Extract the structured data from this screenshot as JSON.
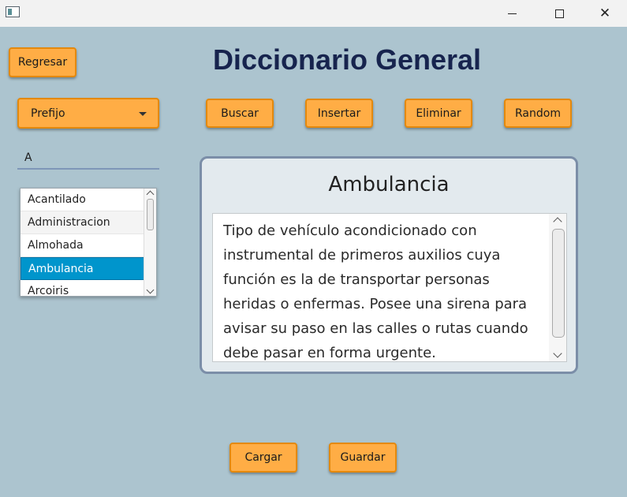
{
  "window": {
    "minimize_glyph": "minimize-icon",
    "maximize_glyph": "maximize-icon",
    "close_glyph": "✕"
  },
  "header": {
    "back_label": "Regresar",
    "title": "Diccionario General"
  },
  "toolbar": {
    "search_label": "Buscar",
    "insert_label": "Insertar",
    "delete_label": "Eliminar",
    "random_label": "Random"
  },
  "filter": {
    "mode_selected": "Prefijo",
    "query_value": "A"
  },
  "word_list": {
    "items": [
      "Acantilado",
      "Administracion",
      "Almohada",
      "Ambulancia",
      "Arcoiris"
    ],
    "selected": "Ambulancia"
  },
  "detail": {
    "word": "Ambulancia",
    "definition": "Tipo de vehículo acondicionado con instrumental de primeros auxilios cuya función es la de transportar personas heridas o enfermas. Posee una sirena para avisar su paso en las calles o rutas cuando debe pasar en forma urgente."
  },
  "footer": {
    "load_label": "Cargar",
    "save_label": "Guardar"
  },
  "colors": {
    "background": "#acc4cf",
    "button": "#ffad45",
    "button_border": "#e4890d",
    "title": "#17244e",
    "selected_row": "#0095cc"
  }
}
